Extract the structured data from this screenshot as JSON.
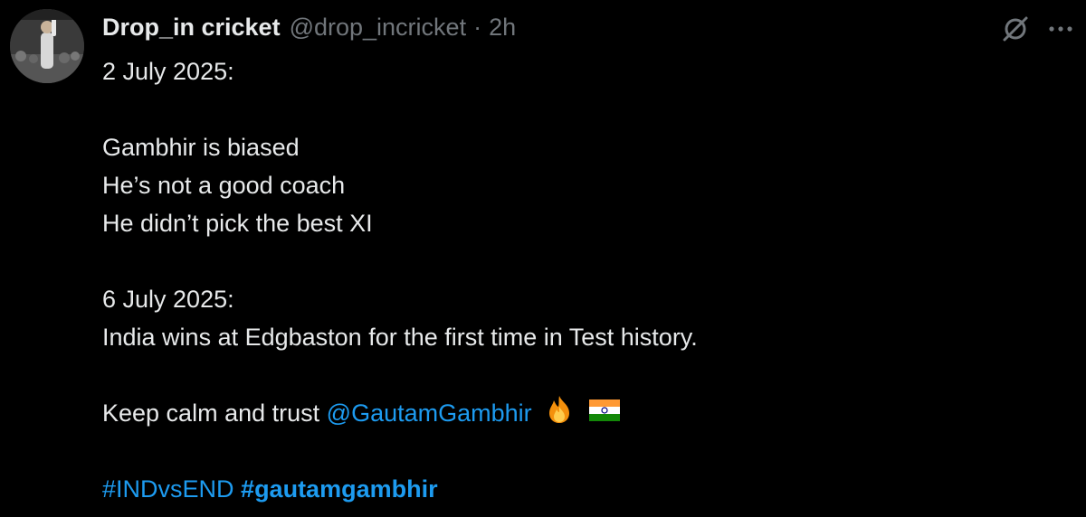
{
  "tweet": {
    "display_name": "Drop_in cricket",
    "handle": "@drop_incricket",
    "separator": "·",
    "time": "2h",
    "icons": {
      "more": "more-icon",
      "grok": "grok-icon"
    },
    "lines": {
      "l1": "2 July 2025:",
      "l2": "Gambhir is biased",
      "l3": "He’s not a good coach",
      "l4": "He didn’t pick the best XI",
      "l5": "6 July 2025:",
      "l6": "India wins at Edgbaston for the first time in Test history.",
      "l7_prefix": "Keep calm and trust",
      "mention": "@GautamGambhir",
      "hashtag1": "#INDvsEND",
      "hashtag2": "#gautamgambhir"
    },
    "emojis": [
      "fire-emoji",
      "india-flag-emoji"
    ],
    "colors": {
      "background": "#000000",
      "text": "#e7e9ea",
      "muted": "#71767b",
      "link": "#1d9bf0"
    }
  }
}
